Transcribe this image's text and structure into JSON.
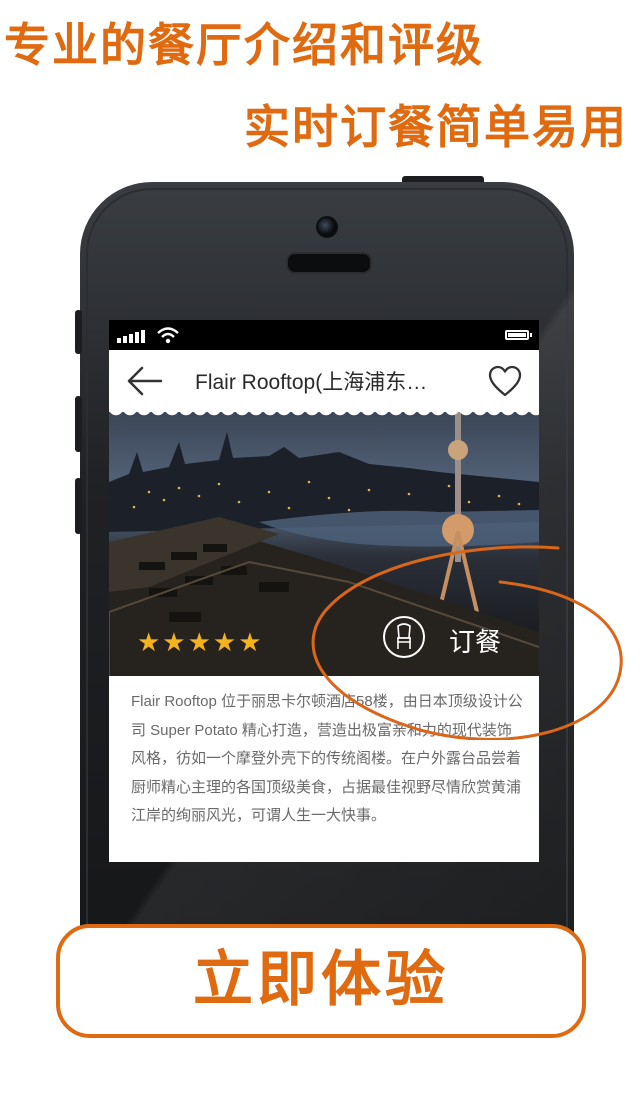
{
  "headline": {
    "line1": "专业的餐厅介绍和评级",
    "line2": "实时订餐简单易用"
  },
  "app": {
    "title": "Flair Rooftop(上海浦东…",
    "rating_stars": 5,
    "stars_text": "★★★★★",
    "order_label": "订餐",
    "description": "Flair Rooftop 位于丽思卡尔顿酒店58楼，由日本顶级设计公司 Super Potato 精心打造，营造出极富亲和力的现代装饰风格，彷如一个摩登外壳下的传统阁楼。在户外露台品尝着厨师精心主理的各国顶级美食，占据最佳视野尽情欣赏黄浦江岸的绚丽风光，可谓人生一大快事。"
  },
  "cta": {
    "label": "立即体验"
  },
  "colors": {
    "accent": "#e06a10",
    "star": "#f4b31c"
  },
  "icons": [
    "back-arrow-icon",
    "heart-icon",
    "chair-icon",
    "signal-icon",
    "wifi-icon",
    "battery-icon"
  ]
}
